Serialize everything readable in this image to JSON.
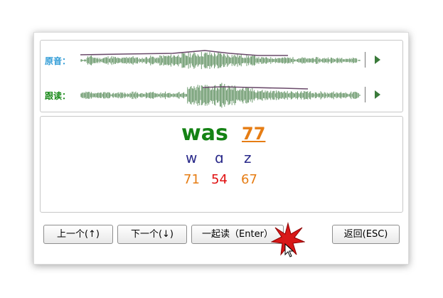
{
  "tracks": {
    "original_label": "原音：",
    "follow_label": "跟读："
  },
  "word": {
    "text": "was",
    "score": "77",
    "phonemes": [
      {
        "symbol": "w",
        "score": "71",
        "color": "#e67d14"
      },
      {
        "symbol": "ɑ",
        "score": "54",
        "color": "#e01010"
      },
      {
        "symbol": "z",
        "score": "67",
        "color": "#e67d14"
      }
    ]
  },
  "buttons": {
    "prev": "上一个(↑)",
    "next": "下一个(↓)",
    "together": "一起读（Enter）",
    "back": "返回(ESC)"
  },
  "colors": {
    "original_label": "#2e9bd6",
    "follow_label": "#1a8a1a",
    "waveform": "#5f9060",
    "pitch_line": "#6a4a6a",
    "word": "#148214",
    "word_score": "#e67d14"
  },
  "icons": [
    "play-icon",
    "click-burst-icon",
    "mouse-cursor-icon"
  ]
}
